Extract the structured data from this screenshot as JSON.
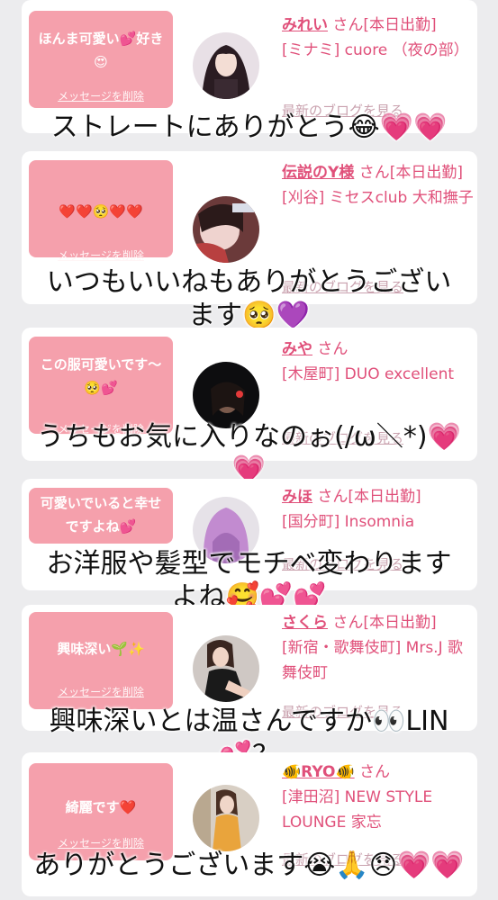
{
  "bubbles": {
    "delete_label": "メッセージを削除"
  },
  "cards": [
    {
      "message": "ほんま可愛い💕好き😍",
      "name": "みれい",
      "suffix": "さん[本日出勤]",
      "shop": "[ミナミ] cuore （夜の部）",
      "blog": "最新のブログを見る",
      "caption": "ストレートにありがとう😂💗💗"
    },
    {
      "message": "❤️❤️🥺❤️❤️",
      "name": "伝説のY様",
      "suffix": "さん[本日出勤]",
      "shop": "[刈谷] ミセスclub 大和撫子",
      "blog": "最新のブログを見る",
      "caption_line1": "いつもいいねもありがとうござい",
      "caption_line2": "ます🥺💜"
    },
    {
      "message": "この服可愛いです〜🥺💕",
      "name": "みや",
      "suffix": "さん",
      "shop": "[木屋町] DUO excellent",
      "blog": "最新のブログを見る",
      "caption_line1": "うちもお気に入りなのぉ(/ω＼*)💗",
      "caption_line2": "💗"
    },
    {
      "message": "可愛いでいると幸せですよね💕",
      "name": "みほ",
      "suffix": "さん[本日出勤]",
      "shop": "[国分町] Insomnia",
      "blog": "最新のブログを見る",
      "caption_line1": "お洋服や髪型でモチベ変わります",
      "caption_line2": "よね🥰💕💕"
    },
    {
      "message": "興味深い🌱✨",
      "name": "さくら",
      "suffix": "さん[本日出勤]",
      "shop": "[新宿・歌舞伎町] Mrs.J 歌舞伎町",
      "blog": "最新のブログを見る",
      "caption_line1": "興味深いとは温さんですか👀LIN",
      "caption_line2": "💕？"
    },
    {
      "message": "綺麗です❤️",
      "name": "🐠RYO🐠",
      "suffix": "さん",
      "shop": "[津田沼] NEW STYLE LOUNGE 家忘",
      "blog": "最新のブログを見る",
      "caption": "ありがとうございます😭🙏😞💗💗"
    }
  ],
  "colors": {
    "bubble": "#f5a0ac",
    "accent": "#e0507a",
    "background": "#ececee"
  }
}
